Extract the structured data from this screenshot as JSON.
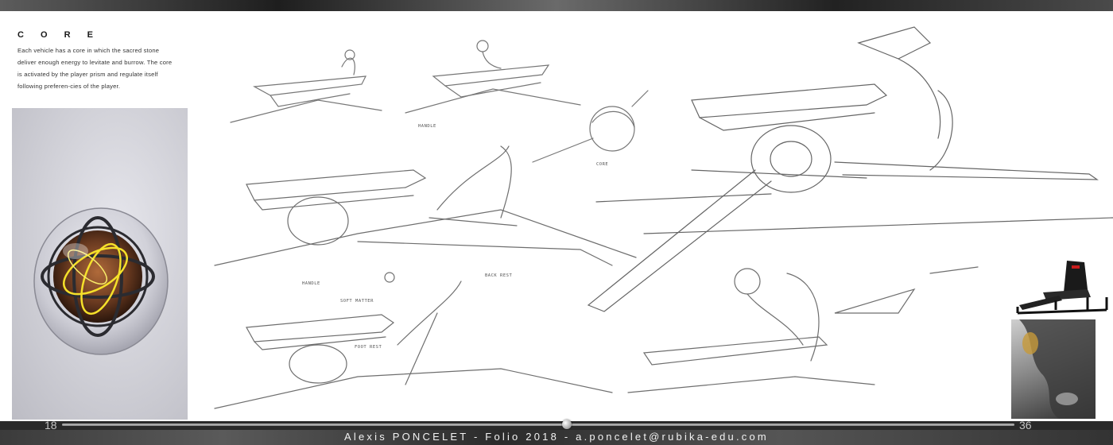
{
  "section": {
    "title": "C O R E",
    "description": "Each vehicle has a core in which the sacred stone deliver enough energy to levitate and burrow. The core is activated by the player prism and regulate itself following preferen-cies of the player."
  },
  "sketch_labels": {
    "handle_top": "HANDLE",
    "handle_bottom": "HANDLE",
    "core": "CORE",
    "back_rest": "BACK REST",
    "soft_matter": "SOFT MATTER",
    "foot_rest": "FOOT REST"
  },
  "pagination": {
    "left_page": "18",
    "right_page": "36",
    "progress": 0.53
  },
  "footer": {
    "text": "Alexis PONCELET - Folio 2018 - a.poncelet@rubika-edu.com"
  },
  "colors": {
    "core_glow": "#f5e02a",
    "core_stone": "#6a3a20",
    "sketch_line": "#555555",
    "footer_bg": "#3b3b3b"
  }
}
